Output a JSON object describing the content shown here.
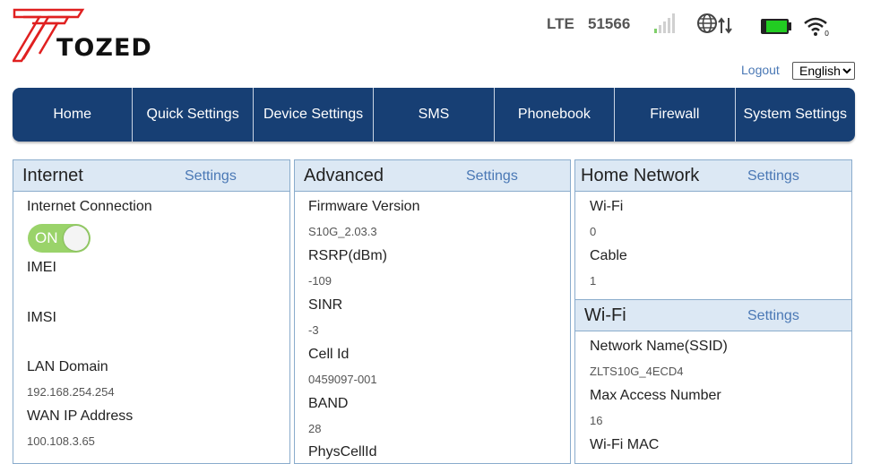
{
  "header": {
    "brand": "TOZED",
    "network_type": "LTE",
    "operator": "51566",
    "signal_icon": "signal-bars-icon",
    "battery_icon": "battery-icon",
    "logout_label": "Logout",
    "language_selected": "English",
    "colors": {
      "brand_red": "#e02020",
      "nav_blue": "#173f74",
      "link_blue": "#4a78b5",
      "battery_green": "#22cc22"
    }
  },
  "nav": {
    "items": [
      {
        "label": "Home"
      },
      {
        "label": "Quick Settings"
      },
      {
        "label": "Device Settings"
      },
      {
        "label": "SMS"
      },
      {
        "label": "Phonebook"
      },
      {
        "label": "Firewall"
      },
      {
        "label": "System Settings"
      }
    ]
  },
  "internet": {
    "title": "Internet",
    "settings_label": "Settings",
    "connection_label": "Internet Connection",
    "toggle_label": "ON",
    "imei_label": "IMEI",
    "imsi_label": "IMSI",
    "lan_domain_label": "LAN Domain",
    "lan_domain_value": "192.168.254.254",
    "wan_ip_label": "WAN IP Address",
    "wan_ip_value": "100.108.3.65"
  },
  "advanced": {
    "title": "Advanced",
    "settings_label": "Settings",
    "firmware_label": "Firmware Version",
    "firmware_value": "S10G_2.03.3",
    "rsrp_label": "RSRP(dBm)",
    "rsrp_value": "-109",
    "sinr_label": "SINR",
    "sinr_value": "-3",
    "cellid_label": "Cell Id",
    "cellid_value": "0459097-001",
    "band_label": "BAND",
    "band_value": "28",
    "physcellid_label": "PhysCellId"
  },
  "home_network": {
    "title": "Home Network",
    "settings_label": "Settings",
    "wifi_label": "Wi-Fi",
    "wifi_value": "0",
    "cable_label": "Cable",
    "cable_value": "1"
  },
  "wifi": {
    "title": "Wi-Fi",
    "settings_label": "Settings",
    "ssid_label": "Network Name(SSID)",
    "ssid_value": "ZLTS10G_4ECD4",
    "max_access_label": "Max Access Number",
    "max_access_value": "16",
    "mac_label": "Wi-Fi MAC"
  }
}
